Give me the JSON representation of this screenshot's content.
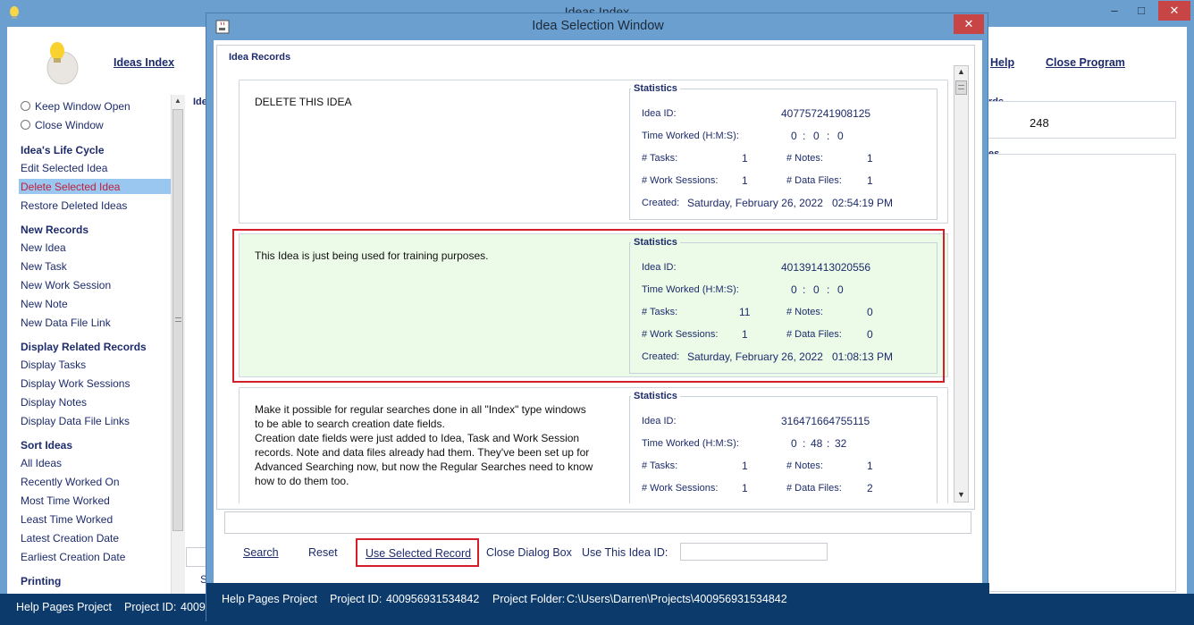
{
  "main_window": {
    "title": "Ideas Index",
    "nav": {
      "ideas_index": "Ideas Index",
      "help": "Help",
      "close_program": "Close Program"
    },
    "right_panel": {
      "records_header_fragment": "rds",
      "records_count": "248",
      "second_header_fragment": "es"
    },
    "center_fragment_label": "Ide",
    "bottom_fragment_label": "S",
    "status_bar": {
      "project": "Help Pages Project",
      "project_id_label": "Project ID:",
      "project_id_fragment": "4009"
    }
  },
  "sidebar": {
    "window_options": [
      {
        "label": "Keep Window Open"
      },
      {
        "label": "Close Window"
      }
    ],
    "sections": [
      {
        "header": "Idea's Life Cycle",
        "items": [
          "Edit Selected Idea",
          "Delete Selected Idea",
          "Restore Deleted Ideas"
        ]
      },
      {
        "header": "New Records",
        "items": [
          "New Idea",
          "New Task",
          "New Work Session",
          "New Note",
          "New Data File Link"
        ]
      },
      {
        "header": "Display Related Records",
        "items": [
          "Display Tasks",
          "Display Work Sessions",
          "Display Notes",
          "Display Data File Links"
        ]
      },
      {
        "header": "Sort Ideas",
        "items": [
          "All Ideas",
          "Recently Worked On",
          "Most Time Worked",
          "Least Time Worked",
          "Latest Creation Date",
          "Earliest Creation Date"
        ]
      },
      {
        "header": "Printing",
        "items": []
      }
    ],
    "selected_item": "Delete Selected Idea"
  },
  "dialog": {
    "title": "Idea Selection Window",
    "group_label": "Idea Records",
    "stats_labels": {
      "group": "Statistics",
      "idea_id": "Idea ID:",
      "time_worked": "Time Worked (H:M:S):",
      "tasks": "# Tasks:",
      "notes": "# Notes:",
      "sessions": "# Work Sessions:",
      "data_files": "# Data Files:",
      "created": "Created:",
      "time_sep": ":"
    },
    "records": [
      {
        "description": [
          "DELETE THIS IDEA"
        ],
        "idea_id": "407757241908125",
        "h": "0",
        "m": "0",
        "s": "0",
        "tasks": "1",
        "notes": "1",
        "sessions": "1",
        "data_files": "1",
        "created_date": "Saturday, February 26, 2022",
        "created_time": "02:54:19 PM",
        "selected": false
      },
      {
        "description": [
          "This Idea is just being used for training purposes."
        ],
        "idea_id": "401391413020556",
        "h": "0",
        "m": "0",
        "s": "0",
        "tasks": "11",
        "notes": "0",
        "sessions": "1",
        "data_files": "0",
        "created_date": "Saturday, February 26, 2022",
        "created_time": "01:08:13 PM",
        "selected": true
      },
      {
        "description": [
          "Make it possible for regular searches done in all \"Index\" type windows",
          "to be able to search creation date fields.",
          "Creation date fields were just added to Idea, Task and Work Session",
          "records. Note and data files already had them. They've been set up for",
          "Advanced Searching now, but now the Regular Searches need to know",
          "how to do them too."
        ],
        "idea_id": "316471664755115",
        "h": "0",
        "m": "48",
        "s": "32",
        "tasks": "1",
        "notes": "1",
        "sessions": "1",
        "data_files": "2",
        "created_date": "",
        "created_time": "",
        "selected": false
      }
    ],
    "buttons": {
      "search": "Search",
      "reset": "Reset",
      "use_selected": "Use Selected Record",
      "close_dialog": "Close Dialog Box",
      "use_this_id_label": "Use This Idea ID:"
    },
    "use_this_id_value": "",
    "status_bar": {
      "project": "Help Pages Project",
      "project_id_label": "Project ID:",
      "project_id": "400956931534842",
      "project_folder_label": "Project Folder:",
      "project_folder": "C:\\Users\\Darren\\Projects\\400956931534842"
    }
  }
}
